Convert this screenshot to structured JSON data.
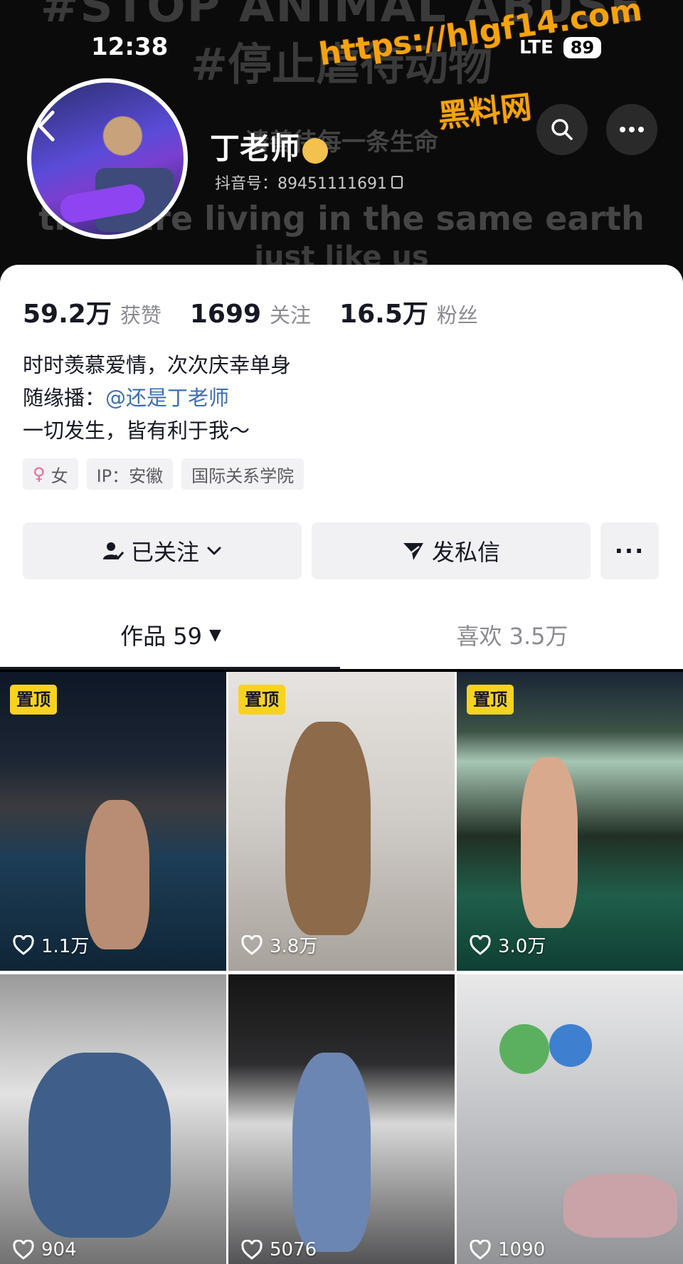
{
  "header": {
    "banner_lines": [
      "#STOP ANIMAL ABUSE",
      "#停止虐待动物",
      "请善待每一条生命",
      "they are living in the same earth",
      "just like us"
    ],
    "status_time": "12:38",
    "status_network": "LTE",
    "status_battery": "89",
    "watermark_url": "https://hlgf14.com",
    "watermark_cn": "黑料网",
    "back_icon": "chevron-left-icon",
    "nickname": "丁老师",
    "nickname_emoji": "teacher-emoji",
    "douyin_id": "抖音号：89451111691",
    "search_icon": "search-icon",
    "more_icon": "more-horizontal-icon"
  },
  "stats": [
    {
      "value": "59.2万",
      "label": "获赞"
    },
    {
      "value": "1699",
      "label": "关注"
    },
    {
      "value": "16.5万",
      "label": "粉丝"
    }
  ],
  "bio": {
    "line1": "时时羡慕爱情，次次庆幸单身",
    "line2_prefix": "随缘播：",
    "line2_mention": "@还是丁老师",
    "line3": "一切发生，皆有利于我～"
  },
  "tags": {
    "gender": "女",
    "ip": "IP：安徽",
    "school": "国际关系学院"
  },
  "actions": {
    "follow_label": "已关注",
    "message_label": "发私信",
    "more_label": "···"
  },
  "tabs": {
    "works": "作品 59",
    "likes": "喜欢 3.5万"
  },
  "grid": {
    "pin_label": "置顶",
    "tiles": [
      {
        "likes": "1.1万",
        "pinned": true
      },
      {
        "likes": "3.8万",
        "pinned": true
      },
      {
        "likes": "3.0万",
        "pinned": true
      },
      {
        "likes": "904",
        "pinned": false
      },
      {
        "likes": "5076",
        "pinned": false
      },
      {
        "likes": "1090",
        "pinned": false
      }
    ]
  },
  "colors": {
    "accent_pin": "#f7d320",
    "mention": "#3d6fb2",
    "watermark": "#f5a30f"
  }
}
